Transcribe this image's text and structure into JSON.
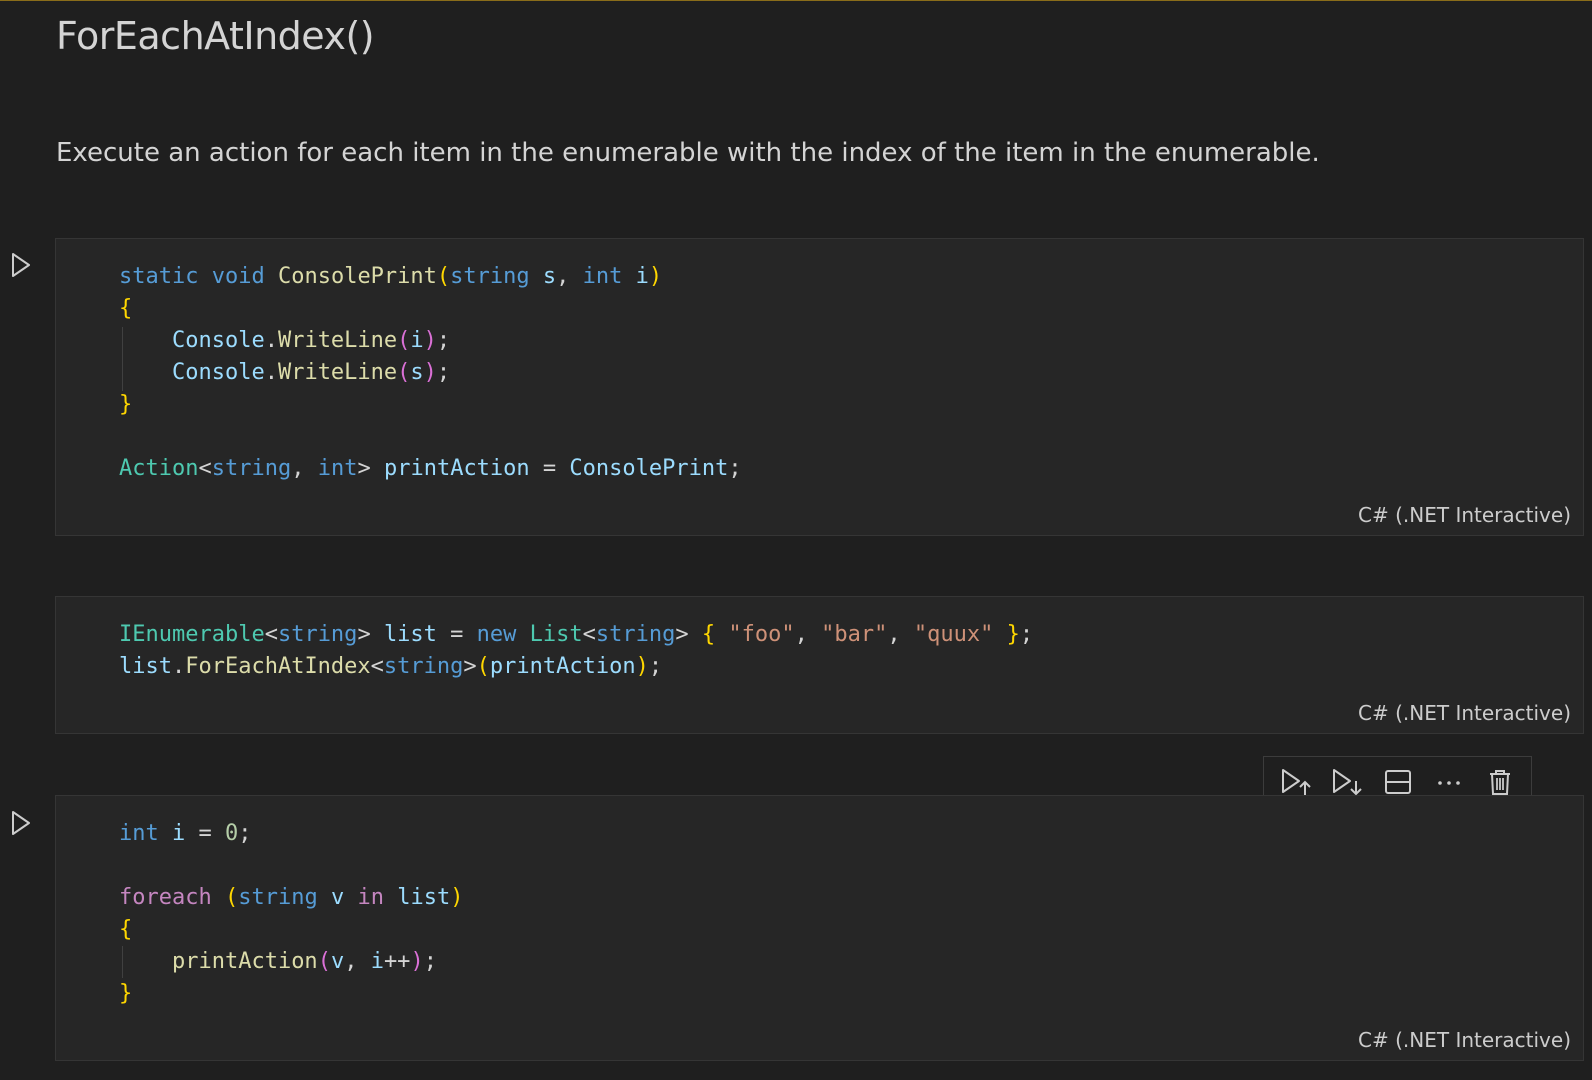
{
  "heading": "ForEachAtIndex()",
  "description": "Execute an action for each item in the enumerable with the index of the item in the enumerable.",
  "cells": [
    {
      "language": "C# (.NET Interactive)",
      "lines": [
        "static void ConsolePrint(string s, int i)",
        "{",
        "    Console.WriteLine(i);",
        "    Console.WriteLine(s);",
        "}",
        "",
        "Action<string, int> printAction = ConsolePrint;"
      ]
    },
    {
      "language": "C# (.NET Interactive)",
      "lines": [
        "IEnumerable<string> list = new List<string> { \"foo\", \"bar\", \"quux\" };",
        "list.ForEachAtIndex<string>(printAction);"
      ]
    },
    {
      "language": "C# (.NET Interactive)",
      "lines": [
        "int i = 0;",
        "",
        "foreach (string v in list)",
        "{",
        "    printAction(v, i++);",
        "}"
      ]
    }
  ],
  "toolbar_icons": [
    "execute-above-icon",
    "execute-below-icon",
    "split-cell-icon",
    "more-actions-icon",
    "delete-icon"
  ],
  "colors": {
    "background": "#1f1f1f",
    "cell_background": "#262626",
    "keyword": "#569cd6",
    "control": "#c586c0",
    "function": "#dcdcaa",
    "type": "#4ec9b0",
    "variable": "#9cdcfe",
    "string": "#ce9178",
    "number": "#b5cea8",
    "bracket_gold": "#ffd700",
    "bracket_purple": "#da70d6"
  }
}
